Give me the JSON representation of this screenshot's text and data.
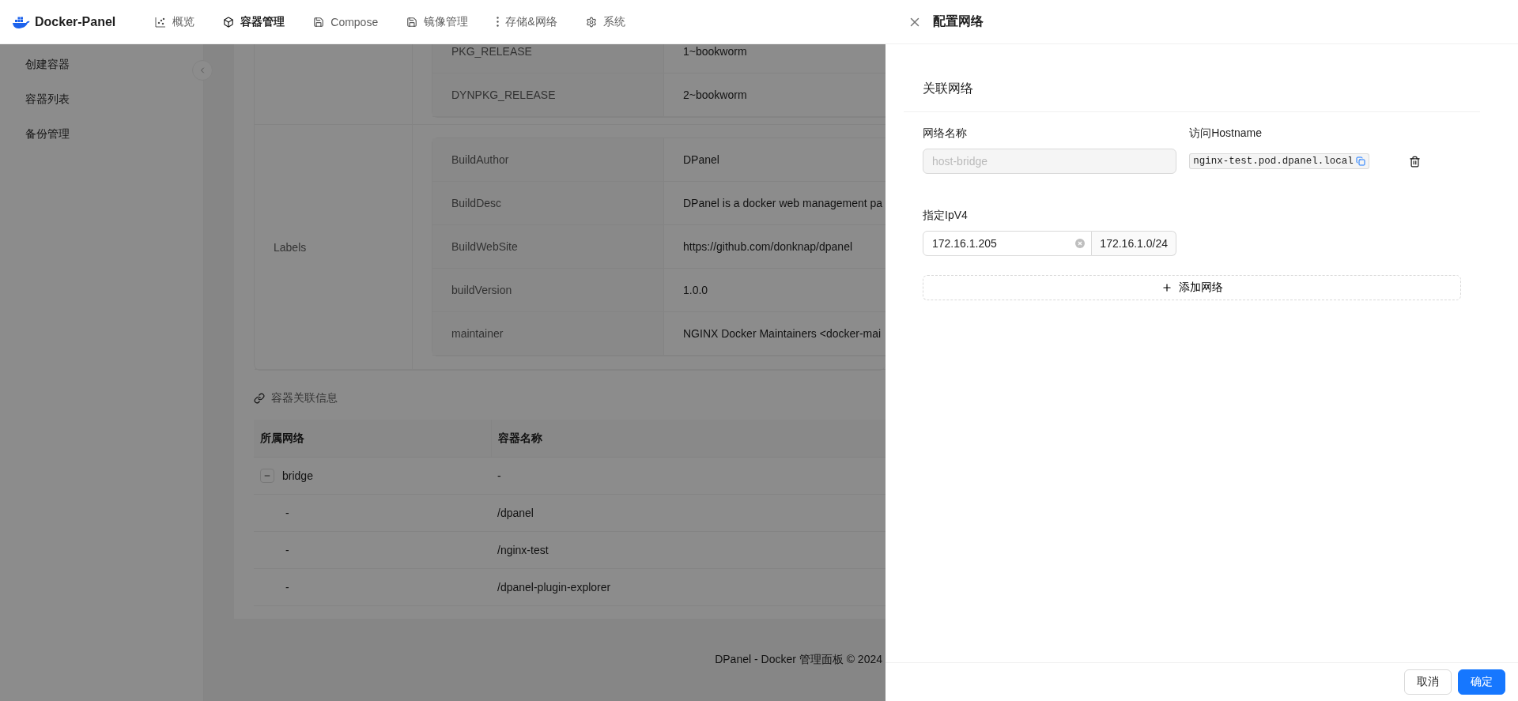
{
  "header": {
    "brand": "Docker-Panel",
    "nav": [
      {
        "label": "概览",
        "kind": "chart",
        "selected": false
      },
      {
        "label": "容器管理",
        "kind": "container",
        "selected": true
      },
      {
        "label": "Compose",
        "kind": "save",
        "selected": false
      },
      {
        "label": "镜像管理",
        "kind": "save",
        "selected": false
      },
      {
        "label": "存储&网络",
        "kind": "dots",
        "selected": false
      },
      {
        "label": "系统",
        "kind": "gear",
        "selected": false
      }
    ]
  },
  "sidebar": {
    "items": [
      {
        "label": "创建容器",
        "selected": false
      },
      {
        "label": "容器列表",
        "selected": false
      },
      {
        "label": "备份管理",
        "selected": false
      }
    ]
  },
  "details": {
    "env_rows": [
      {
        "key": "PKG_RELEASE",
        "value": "1~bookworm"
      },
      {
        "key": "DYNPKG_RELEASE",
        "value": "2~bookworm"
      }
    ],
    "labels_title": "Labels",
    "label_rows": [
      {
        "key": "BuildAuthor",
        "value": "DPanel"
      },
      {
        "key": "BuildDesc",
        "value": "DPanel is a docker web management pa"
      },
      {
        "key": "BuildWebSite",
        "value": "https://github.com/donknap/dpanel"
      },
      {
        "key": "buildVersion",
        "value": "1.0.0"
      },
      {
        "key": "maintainer",
        "value": "NGINX Docker Maintainers <docker-mai"
      }
    ]
  },
  "links": {
    "title": "容器关联信息",
    "columns": [
      "所属网络",
      "容器名称"
    ],
    "rows": [
      {
        "network": "bridge",
        "container": "-",
        "expanded": true,
        "children": [
          {
            "network": "-",
            "container": "/dpanel"
          },
          {
            "network": "-",
            "container": "/nginx-test"
          },
          {
            "network": "-",
            "container": "/dpanel-plugin-explorer"
          }
        ]
      }
    ]
  },
  "footer": "DPanel - Docker 管理面板 © 2024",
  "drawer": {
    "title": "配置网络",
    "section": "关联网络",
    "networks": [
      {
        "name_label": "网络名称",
        "name_value": "host-bridge",
        "name_disabled": true,
        "hostname_label": "访问Hostname",
        "hostname": "nginx-test.pod.dpanel.local",
        "ipv4_label": "指定IpV4",
        "ipv4_value": "172.16.1.205",
        "subnet": "172.16.1.0/24"
      }
    ],
    "add_button": "添加网络",
    "buttons": [
      {
        "label": "取消",
        "kind": "default"
      },
      {
        "label": "确定",
        "kind": "primary"
      }
    ]
  }
}
